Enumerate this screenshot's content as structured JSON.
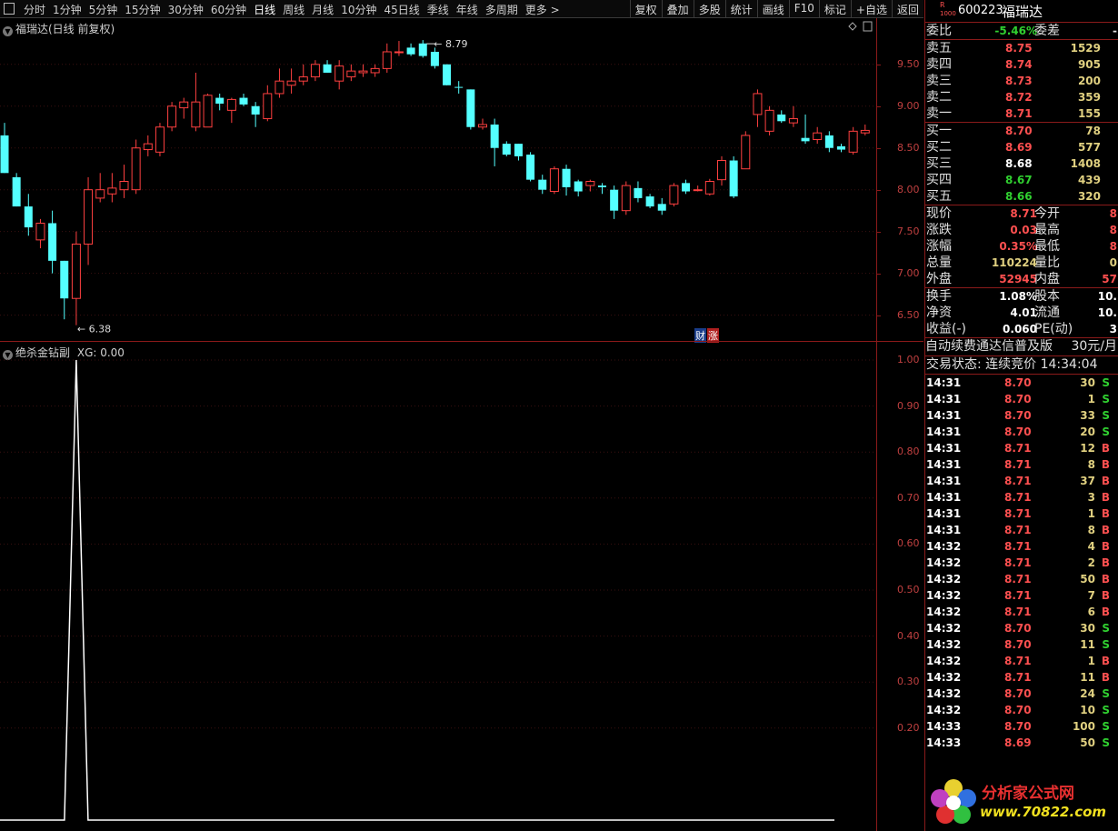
{
  "toolbar": {
    "periods": [
      "分时",
      "1分钟",
      "5分钟",
      "15分钟",
      "30分钟",
      "60分钟",
      "日线",
      "周线",
      "月线",
      "10分钟",
      "45日线",
      "季线",
      "年线",
      "多周期",
      "更多 >"
    ],
    "active_period": "日线",
    "tools": [
      "复权",
      "叠加",
      "多股",
      "统计",
      "画线",
      "F10",
      "标记",
      "+自选",
      "返回"
    ]
  },
  "main_chart": {
    "title": "福瑞达(日线 前复权)",
    "high_label": "8.79",
    "low_label": "6.38",
    "y_ticks": [
      "9.50",
      "9.00",
      "8.50",
      "8.00",
      "7.50",
      "7.00",
      "6.50"
    ],
    "tag_cai": "财",
    "tag_zhang": "涨",
    "colors": {
      "up": "#ff4040",
      "down": "#54ffff",
      "axis": "#8b1a1a"
    }
  },
  "chart_data": {
    "type": "candlestick",
    "ylim": [
      6.3,
      9.9
    ],
    "candles": [
      {
        "o": 8.65,
        "h": 8.8,
        "l": 8.2,
        "c": 8.2
      },
      {
        "o": 8.15,
        "h": 8.2,
        "l": 7.8,
        "c": 7.8
      },
      {
        "o": 7.8,
        "h": 7.95,
        "l": 7.45,
        "c": 7.55
      },
      {
        "o": 7.4,
        "h": 7.65,
        "l": 7.3,
        "c": 7.6
      },
      {
        "o": 7.6,
        "h": 7.75,
        "l": 7.0,
        "c": 7.15
      },
      {
        "o": 7.15,
        "h": 7.15,
        "l": 6.45,
        "c": 6.7
      },
      {
        "o": 6.7,
        "h": 7.5,
        "l": 6.38,
        "c": 7.35
      },
      {
        "o": 7.35,
        "h": 8.15,
        "l": 7.1,
        "c": 8.0
      },
      {
        "o": 7.9,
        "h": 8.2,
        "l": 7.85,
        "c": 8.0
      },
      {
        "o": 7.95,
        "h": 8.2,
        "l": 7.85,
        "c": 8.02
      },
      {
        "o": 8.0,
        "h": 8.3,
        "l": 7.9,
        "c": 8.1
      },
      {
        "o": 8.0,
        "h": 8.6,
        "l": 7.95,
        "c": 8.5
      },
      {
        "o": 8.48,
        "h": 8.65,
        "l": 8.4,
        "c": 8.55
      },
      {
        "o": 8.45,
        "h": 8.8,
        "l": 8.4,
        "c": 8.75
      },
      {
        "o": 8.75,
        "h": 9.05,
        "l": 8.7,
        "c": 9.0
      },
      {
        "o": 8.98,
        "h": 9.1,
        "l": 8.85,
        "c": 9.05
      },
      {
        "o": 8.75,
        "h": 9.4,
        "l": 8.7,
        "c": 9.05
      },
      {
        "o": 8.75,
        "h": 9.15,
        "l": 8.75,
        "c": 9.13
      },
      {
        "o": 9.1,
        "h": 9.15,
        "l": 8.95,
        "c": 9.03
      },
      {
        "o": 8.95,
        "h": 9.1,
        "l": 8.8,
        "c": 9.08
      },
      {
        "o": 9.1,
        "h": 9.15,
        "l": 9.0,
        "c": 9.02
      },
      {
        "o": 9.0,
        "h": 9.05,
        "l": 8.75,
        "c": 8.9
      },
      {
        "o": 8.85,
        "h": 9.25,
        "l": 8.82,
        "c": 9.15
      },
      {
        "o": 9.15,
        "h": 9.45,
        "l": 9.1,
        "c": 9.3
      },
      {
        "o": 9.25,
        "h": 9.45,
        "l": 9.15,
        "c": 9.3
      },
      {
        "o": 9.3,
        "h": 9.5,
        "l": 9.25,
        "c": 9.35
      },
      {
        "o": 9.35,
        "h": 9.55,
        "l": 9.3,
        "c": 9.5
      },
      {
        "o": 9.5,
        "h": 9.55,
        "l": 9.4,
        "c": 9.4
      },
      {
        "o": 9.3,
        "h": 9.55,
        "l": 9.2,
        "c": 9.48
      },
      {
        "o": 9.35,
        "h": 9.5,
        "l": 9.3,
        "c": 9.42
      },
      {
        "o": 9.4,
        "h": 9.5,
        "l": 9.35,
        "c": 9.42
      },
      {
        "o": 9.4,
        "h": 9.5,
        "l": 9.35,
        "c": 9.45
      },
      {
        "o": 9.45,
        "h": 9.75,
        "l": 9.4,
        "c": 9.65
      },
      {
        "o": 9.65,
        "h": 9.78,
        "l": 9.6,
        "c": 9.65
      },
      {
        "o": 9.7,
        "h": 9.75,
        "l": 9.6,
        "c": 9.62
      },
      {
        "o": 9.75,
        "h": 9.79,
        "l": 9.58,
        "c": 9.6
      },
      {
        "o": 9.65,
        "h": 9.7,
        "l": 9.45,
        "c": 9.48
      },
      {
        "o": 9.5,
        "h": 9.5,
        "l": 9.25,
        "c": 9.25
      },
      {
        "o": 9.23,
        "h": 9.3,
        "l": 9.15,
        "c": 9.22
      },
      {
        "o": 9.2,
        "h": 9.2,
        "l": 8.72,
        "c": 8.75
      },
      {
        "o": 8.75,
        "h": 8.85,
        "l": 8.72,
        "c": 8.78
      },
      {
        "o": 8.78,
        "h": 8.85,
        "l": 8.28,
        "c": 8.5
      },
      {
        "o": 8.55,
        "h": 8.58,
        "l": 8.4,
        "c": 8.42
      },
      {
        "o": 8.55,
        "h": 8.55,
        "l": 8.35,
        "c": 8.4
      },
      {
        "o": 8.42,
        "h": 8.45,
        "l": 8.1,
        "c": 8.12
      },
      {
        "o": 8.12,
        "h": 8.18,
        "l": 7.95,
        "c": 8.0
      },
      {
        "o": 7.98,
        "h": 8.28,
        "l": 7.95,
        "c": 8.25
      },
      {
        "o": 8.25,
        "h": 8.3,
        "l": 7.93,
        "c": 8.03
      },
      {
        "o": 8.1,
        "h": 8.12,
        "l": 7.92,
        "c": 7.98
      },
      {
        "o": 8.05,
        "h": 8.12,
        "l": 7.98,
        "c": 8.1
      },
      {
        "o": 8.05,
        "h": 8.08,
        "l": 7.95,
        "c": 8.03
      },
      {
        "o": 8.0,
        "h": 8.05,
        "l": 7.65,
        "c": 7.75
      },
      {
        "o": 7.75,
        "h": 8.1,
        "l": 7.7,
        "c": 8.05
      },
      {
        "o": 8.02,
        "h": 8.1,
        "l": 7.85,
        "c": 7.9
      },
      {
        "o": 7.92,
        "h": 7.95,
        "l": 7.78,
        "c": 7.8
      },
      {
        "o": 7.83,
        "h": 7.9,
        "l": 7.7,
        "c": 7.75
      },
      {
        "o": 7.83,
        "h": 8.08,
        "l": 7.8,
        "c": 8.05
      },
      {
        "o": 8.08,
        "h": 8.12,
        "l": 7.95,
        "c": 7.98
      },
      {
        "o": 8.0,
        "h": 8.05,
        "l": 7.98,
        "c": 8.0
      },
      {
        "o": 7.95,
        "h": 8.13,
        "l": 7.93,
        "c": 8.1
      },
      {
        "o": 8.12,
        "h": 8.4,
        "l": 8.05,
        "c": 8.35
      },
      {
        "o": 8.35,
        "h": 8.4,
        "l": 7.9,
        "c": 7.92
      },
      {
        "o": 8.25,
        "h": 8.7,
        "l": 8.25,
        "c": 8.65
      },
      {
        "o": 8.9,
        "h": 9.2,
        "l": 8.75,
        "c": 9.15
      },
      {
        "o": 8.7,
        "h": 9.0,
        "l": 8.65,
        "c": 8.95
      },
      {
        "o": 8.9,
        "h": 8.95,
        "l": 8.8,
        "c": 8.82
      },
      {
        "o": 8.8,
        "h": 9.0,
        "l": 8.75,
        "c": 8.85
      },
      {
        "o": 8.62,
        "h": 8.9,
        "l": 8.55,
        "c": 8.58
      },
      {
        "o": 8.6,
        "h": 8.75,
        "l": 8.55,
        "c": 8.68
      },
      {
        "o": 8.65,
        "h": 8.7,
        "l": 8.45,
        "c": 8.5
      },
      {
        "o": 8.52,
        "h": 8.55,
        "l": 8.45,
        "c": 8.48
      },
      {
        "o": 8.45,
        "h": 8.75,
        "l": 8.42,
        "c": 8.7
      },
      {
        "o": 8.68,
        "h": 8.78,
        "l": 8.65,
        "c": 8.71
      }
    ],
    "indicator": {
      "name": "绝杀金钻副",
      "label": "XG: 0.00",
      "ylim": [
        0,
        1.0
      ],
      "y_ticks": [
        "1.00",
        "0.90",
        "0.80",
        "0.70",
        "0.60",
        "0.50",
        "0.40",
        "0.30",
        "0.20"
      ],
      "spike_index": 6,
      "spike_value": 1.0
    }
  },
  "quote": {
    "code": "600223",
    "name": "福瑞达",
    "r_tag": "R",
    "k_tag": "1000",
    "weibi_label": "委比",
    "weibi_value": "-5.46%",
    "weicha_label": "委差",
    "weicha_value": "-",
    "asks": [
      {
        "label": "卖五",
        "price": "8.75",
        "vol": "1529"
      },
      {
        "label": "卖四",
        "price": "8.74",
        "vol": "905"
      },
      {
        "label": "卖三",
        "price": "8.73",
        "vol": "200"
      },
      {
        "label": "卖二",
        "price": "8.72",
        "vol": "359"
      },
      {
        "label": "卖一",
        "price": "8.71",
        "vol": "155"
      }
    ],
    "bids": [
      {
        "label": "买一",
        "price": "8.70",
        "vol": "78"
      },
      {
        "label": "买二",
        "price": "8.69",
        "vol": "577"
      },
      {
        "label": "买三",
        "price": "8.68",
        "vol": "1408"
      },
      {
        "label": "买四",
        "price": "8.67",
        "vol": "439"
      },
      {
        "label": "买五",
        "price": "8.66",
        "vol": "320"
      }
    ],
    "stats1": [
      {
        "l1": "现价",
        "v1": "8.71",
        "l2": "今开",
        "v2": "8"
      },
      {
        "l1": "涨跌",
        "v1": "0.03",
        "l2": "最高",
        "v2": "8"
      },
      {
        "l1": "涨幅",
        "v1": "0.35%",
        "l2": "最低",
        "v2": "8"
      },
      {
        "l1": "总量",
        "v1": "110224",
        "l2": "量比",
        "v2": "0"
      },
      {
        "l1": "外盘",
        "v1": "52945",
        "l2": "内盘",
        "v2": "57"
      }
    ],
    "stats2": [
      {
        "l1": "换手",
        "v1": "1.08%",
        "l2": "股本",
        "v2": "10."
      },
      {
        "l1": "净资",
        "v1": "4.01",
        "l2": "流通",
        "v2": "10."
      },
      {
        "l1": "收益(-)",
        "v1": "0.060",
        "l2": "PE(动)",
        "v2": "3"
      }
    ],
    "notice": "自动续费通达信普及版",
    "notice_price": "30元/月",
    "trade_status": "交易状态: 连续竞价 14:34:04"
  },
  "ticks": [
    {
      "t": "14:31",
      "p": "8.70",
      "v": "30",
      "d": "S"
    },
    {
      "t": "14:31",
      "p": "8.70",
      "v": "1",
      "d": "S"
    },
    {
      "t": "14:31",
      "p": "8.70",
      "v": "33",
      "d": "S"
    },
    {
      "t": "14:31",
      "p": "8.70",
      "v": "20",
      "d": "S"
    },
    {
      "t": "14:31",
      "p": "8.71",
      "v": "12",
      "d": "B"
    },
    {
      "t": "14:31",
      "p": "8.71",
      "v": "8",
      "d": "B"
    },
    {
      "t": "14:31",
      "p": "8.71",
      "v": "37",
      "d": "B"
    },
    {
      "t": "14:31",
      "p": "8.71",
      "v": "3",
      "d": "B"
    },
    {
      "t": "14:31",
      "p": "8.71",
      "v": "1",
      "d": "B"
    },
    {
      "t": "14:31",
      "p": "8.71",
      "v": "8",
      "d": "B"
    },
    {
      "t": "14:32",
      "p": "8.71",
      "v": "4",
      "d": "B"
    },
    {
      "t": "14:32",
      "p": "8.71",
      "v": "2",
      "d": "B"
    },
    {
      "t": "14:32",
      "p": "8.71",
      "v": "50",
      "d": "B"
    },
    {
      "t": "14:32",
      "p": "8.71",
      "v": "7",
      "d": "B"
    },
    {
      "t": "14:32",
      "p": "8.71",
      "v": "6",
      "d": "B"
    },
    {
      "t": "14:32",
      "p": "8.70",
      "v": "30",
      "d": "S"
    },
    {
      "t": "14:32",
      "p": "8.70",
      "v": "11",
      "d": "S"
    },
    {
      "t": "14:32",
      "p": "8.71",
      "v": "1",
      "d": "B"
    },
    {
      "t": "14:32",
      "p": "8.71",
      "v": "11",
      "d": "B"
    },
    {
      "t": "14:32",
      "p": "8.70",
      "v": "24",
      "d": "S"
    },
    {
      "t": "14:32",
      "p": "8.70",
      "v": "10",
      "d": "S"
    },
    {
      "t": "14:33",
      "p": "8.70",
      "v": "100",
      "d": "S"
    },
    {
      "t": "14:33",
      "p": "8.69",
      "v": "50",
      "d": "S"
    }
  ],
  "watermark": {
    "brand": "分析家公式网",
    "url": "www.70822.com"
  }
}
